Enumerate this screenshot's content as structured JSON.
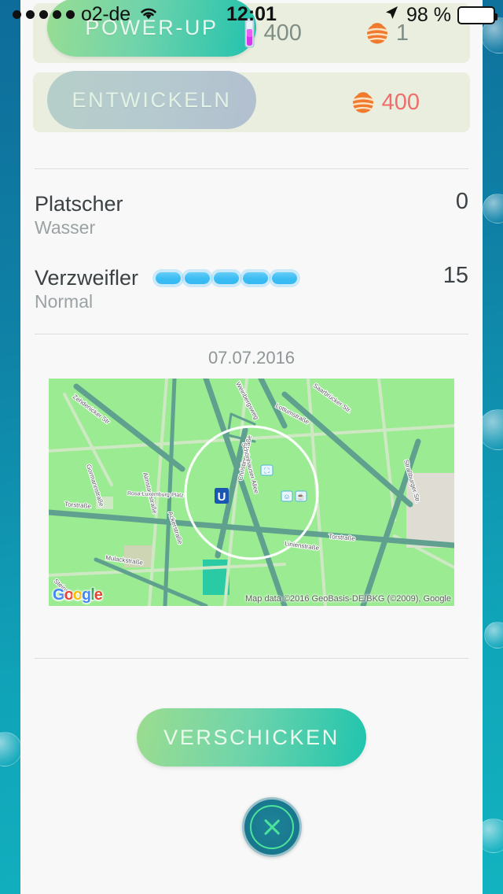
{
  "statusbar": {
    "carrier": "o2-de",
    "signal_dots": 5,
    "wifi_icon": "wifi-icon",
    "time": "12:01",
    "location_icon": "location-arrow-icon",
    "battery_text": "98 %",
    "battery_percent": 98
  },
  "actions": {
    "powerup": {
      "label": "POWER-UP",
      "dust_icon": "stardust-icon",
      "dust_cost": "400",
      "candy_icon": "candy-icon",
      "candy_cost": "1",
      "enabled": true
    },
    "evolve": {
      "label": "ENTWICKELN",
      "candy_icon": "candy-icon",
      "candy_cost": "400",
      "enabled": false
    }
  },
  "moves": [
    {
      "name": "Platscher",
      "type": "Wasser",
      "damage": "0",
      "energy_bars": 0
    },
    {
      "name": "Verzweifler",
      "type": "Normal",
      "damage": "15",
      "energy_bars": 5
    }
  ],
  "catch": {
    "date": "07.07.2016",
    "map": {
      "attribution": "Map data ©2016 GeoBasis-DE/BKG (©2009), Google",
      "logo": "Google",
      "station_label": "Rosa-Luxemburg-Platz",
      "station_icon": "u-bahn-icon",
      "streets": [
        "Zehdenicker Str",
        "Torstraße",
        "Christinenstraße",
        "Lottumstraße",
        "Weinbergsweg",
        "Saarbrücker Str.",
        "Schönhauser Allee",
        "Straßburger Str.",
        "Linienstraße",
        "Mulackstraße",
        "Steinstr.",
        "Gormannstraße",
        "Almstadtstraße",
        "Torstraße"
      ]
    }
  },
  "transfer": {
    "label": "VERSCHICKEN"
  },
  "close": {
    "icon": "close-x-icon"
  },
  "colors": {
    "accent_green": "#1fc4ae",
    "candy_orange": "#ef7135",
    "cost_red": "#ef6d6a",
    "energy_blue": "#3bbdf4",
    "card_bg": "#f7f8f7",
    "row_bg": "#eaeedf",
    "map_green": "#9aeb91"
  }
}
